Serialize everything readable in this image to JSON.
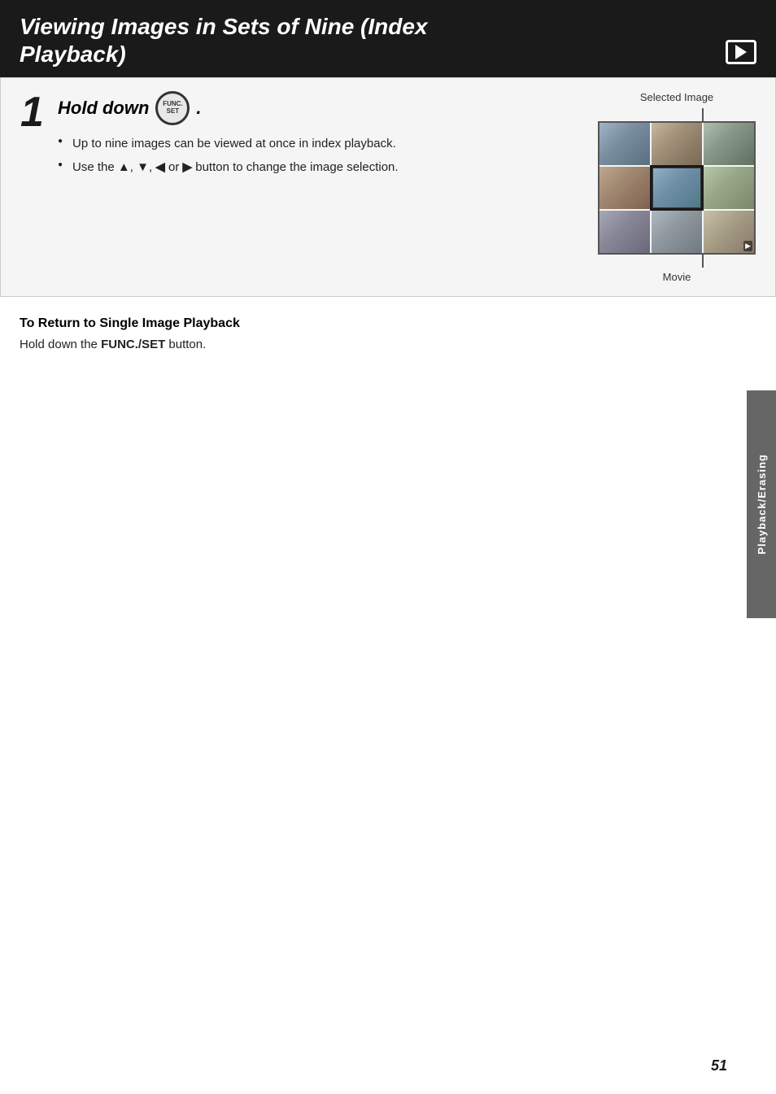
{
  "header": {
    "title_line1": "Viewing Images in Sets of Nine (Index",
    "title_line2": "Playback)",
    "icon_label": "playback-icon"
  },
  "step1": {
    "number": "1",
    "title_text": "Hold down",
    "title_period": ".",
    "func_btn_line1": "FUNC.",
    "func_btn_line2": "SET",
    "bullets": [
      "Up to nine images can be viewed at once in index playback.",
      "Use the ▲, ▼, ◀ or ▶ button to change the image selection."
    ],
    "selected_image_label": "Selected Image",
    "movie_label": "Movie"
  },
  "return_section": {
    "title": "To Return to Single Image Playback",
    "text_prefix": "Hold down the ",
    "text_bold": "FUNC./SET",
    "text_suffix": " button."
  },
  "side_tab": {
    "label": "Playback/Erasing"
  },
  "page_number": "51"
}
